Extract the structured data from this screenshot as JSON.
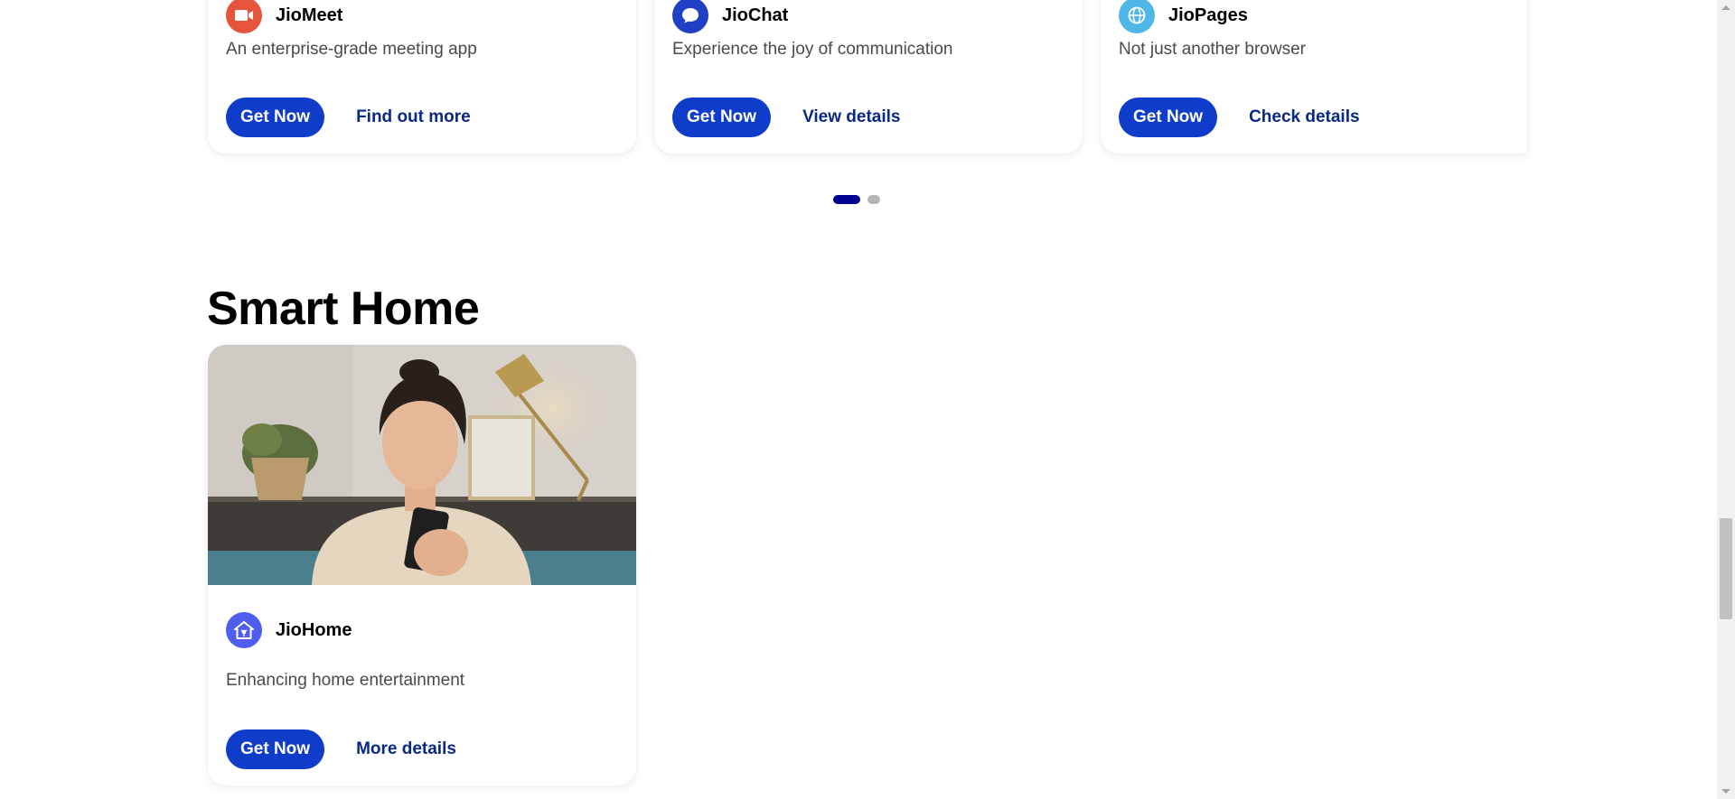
{
  "apps_row": [
    {
      "name": "JioMeet",
      "description": "An enterprise-grade meeting app",
      "primary_label": "Get Now",
      "secondary_label": "Find out more",
      "icon": "video-meeting-icon",
      "color": "#e5553b"
    },
    {
      "name": "JioChat",
      "description": "Experience the joy of communication",
      "primary_label": "Get Now",
      "secondary_label": "View details",
      "icon": "chat-bubble-icon",
      "color": "#1f3fc4"
    },
    {
      "name": "JioPages",
      "description": "Not just another browser",
      "primary_label": "Get Now",
      "secondary_label": "Check details",
      "icon": "globe-icon",
      "color": "#4fb6e8"
    }
  ],
  "carousel": {
    "pages": 2,
    "active_page": 1
  },
  "smart_home": {
    "title": "Smart Home",
    "card": {
      "image": "woman-using-smartphone-photo",
      "name": "JioHome",
      "description": "Enhancing home entertainment",
      "primary_label": "Get Now",
      "secondary_label": "More details",
      "icon": "smart-home-icon",
      "color": "#4f5ef0"
    }
  },
  "colors": {
    "primary_button": "#0f3cc9",
    "link": "#0a2885",
    "dot_active": "#000093",
    "dot_inactive": "#b5b5b5"
  }
}
